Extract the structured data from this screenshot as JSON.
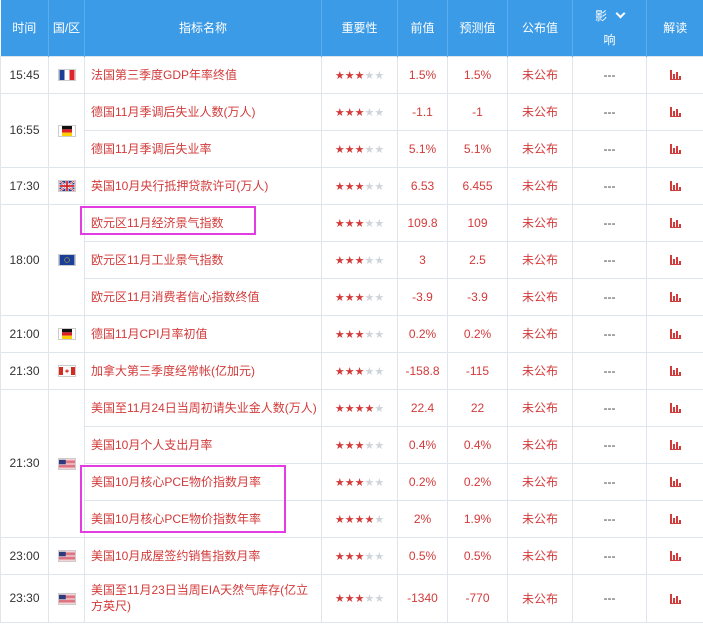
{
  "header": {
    "time": "时间",
    "country": "国/区",
    "indicator": "指标名称",
    "importance": "重要性",
    "previous": "前值",
    "forecast": "预测值",
    "actual": "公布值",
    "impact_top": "影",
    "impact_bottom": "响",
    "analysis": "解读"
  },
  "colors": {
    "header_bg": "#3c9be6",
    "accent_red": "#d33a3a",
    "highlight": "#e23ce2"
  },
  "rows": [
    {
      "time": "15:45",
      "flag": "france-flag-icon",
      "name": "法国第三季度GDP年率终值",
      "stars": 3,
      "previous": "1.5%",
      "forecast": "1.5%",
      "actual": "未公布",
      "impact": "---"
    },
    {
      "time": "16:55",
      "flag": "germany-flag-icon",
      "name": "德国11月季调后失业人数(万人)",
      "stars": 3,
      "previous": "-1.1",
      "forecast": "-1",
      "actual": "未公布",
      "impact": "---"
    },
    {
      "name": "德国11月季调后失业率",
      "stars": 3,
      "previous": "5.1%",
      "forecast": "5.1%",
      "actual": "未公布",
      "impact": "---"
    },
    {
      "time": "17:30",
      "flag": "uk-flag-icon",
      "name": "英国10月央行抵押贷款许可(万人)",
      "stars": 3,
      "previous": "6.53",
      "forecast": "6.455",
      "actual": "未公布",
      "impact": "---"
    },
    {
      "time": "18:00",
      "flag": "eu-flag-icon",
      "name": "欧元区11月经济景气指数",
      "stars": 3,
      "previous": "109.8",
      "forecast": "109",
      "actual": "未公布",
      "impact": "---"
    },
    {
      "name": "欧元区11月工业景气指数",
      "stars": 3,
      "previous": "3",
      "forecast": "2.5",
      "actual": "未公布",
      "impact": "---"
    },
    {
      "name": "欧元区11月消费者信心指数终值",
      "stars": 3,
      "previous": "-3.9",
      "forecast": "-3.9",
      "actual": "未公布",
      "impact": "---"
    },
    {
      "time": "21:00",
      "flag": "germany-flag-icon",
      "name": "德国11月CPI月率初值",
      "stars": 3,
      "previous": "0.2%",
      "forecast": "0.2%",
      "actual": "未公布",
      "impact": "---"
    },
    {
      "time": "21:30",
      "flag": "canada-flag-icon",
      "name": "加拿大第三季度经常帐(亿加元)",
      "stars": 3,
      "previous": "-158.8",
      "forecast": "-115",
      "actual": "未公布",
      "impact": "---"
    },
    {
      "time": "21:30",
      "flag": "usa-flag-icon",
      "name": "美国至11月24日当周初请失业金人数(万人)",
      "stars": 4,
      "previous": "22.4",
      "forecast": "22",
      "actual": "未公布",
      "impact": "---"
    },
    {
      "name": "美国10月个人支出月率",
      "stars": 3,
      "previous": "0.4%",
      "forecast": "0.4%",
      "actual": "未公布",
      "impact": "---"
    },
    {
      "name": "美国10月核心PCE物价指数月率",
      "stars": 3,
      "previous": "0.2%",
      "forecast": "0.2%",
      "actual": "未公布",
      "impact": "---"
    },
    {
      "name": "美国10月核心PCE物价指数年率",
      "stars": 4,
      "previous": "2%",
      "forecast": "1.9%",
      "actual": "未公布",
      "impact": "---"
    },
    {
      "time": "23:00",
      "flag": "usa-flag-icon",
      "name": "美国10月成屋签约销售指数月率",
      "stars": 3,
      "previous": "0.5%",
      "forecast": "0.5%",
      "actual": "未公布",
      "impact": "---"
    },
    {
      "time": "23:30",
      "flag": "usa-flag-icon",
      "name": "美国至11月23日当周EIA天然气库存(亿立方英尺)",
      "stars": 3,
      "previous": "-1340",
      "forecast": "-770",
      "actual": "未公布",
      "impact": "---"
    }
  ]
}
